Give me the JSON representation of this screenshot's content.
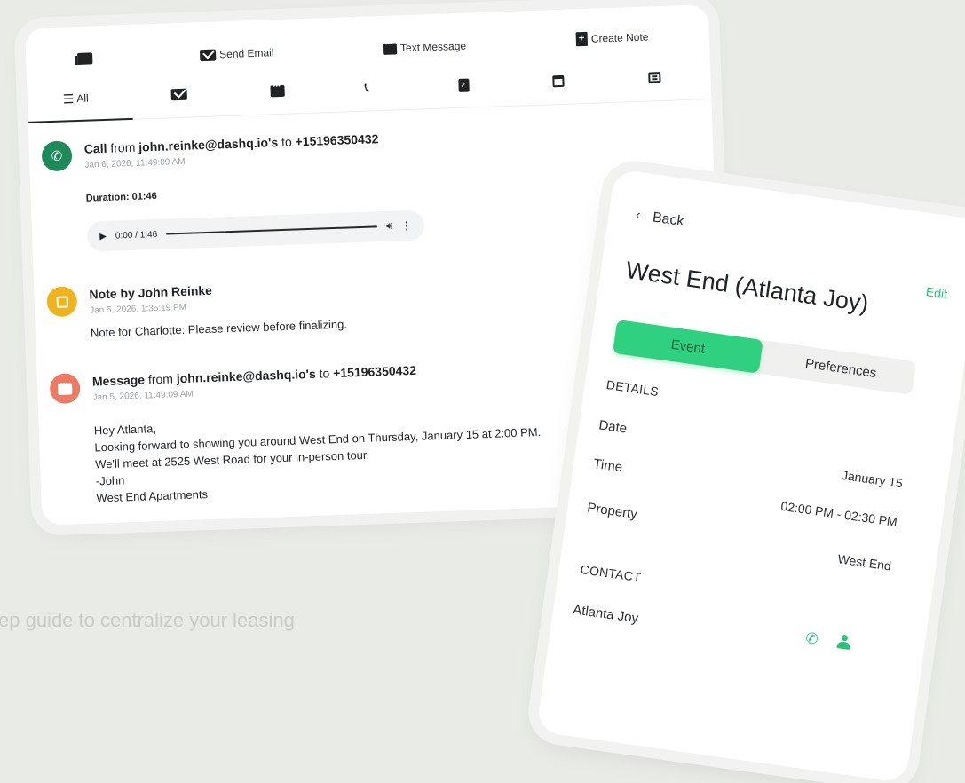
{
  "activity": {
    "toolbar": {
      "send_email": "Send Email",
      "text_message": "Text Message",
      "create_note": "Create Note"
    },
    "filters": {
      "all": "All"
    },
    "entries": [
      {
        "type_label": "Call",
        "from_word": "from",
        "sender": "john.reinke@dashq.io's",
        "to_word": "to",
        "recipient": "+15196350432",
        "time": "Jan 6, 2026, 11:49:09 AM",
        "duration": "Duration: 01:46",
        "player_time": "0:00 / 1:46"
      },
      {
        "type_label": "Note by John Reinke",
        "time": "Jan 5, 2026, 1:35:19 PM",
        "body": "Note for Charlotte: Please review before finalizing."
      },
      {
        "type_label": "Message",
        "from_word": "from",
        "sender": "john.reinke@dashq.io's",
        "to_word": "to",
        "recipient": "+15196350432",
        "time": "Jan 5, 2026, 11:49:09 AM",
        "body_lines": [
          "Hey Atlanta,",
          "Looking forward to showing you around West End on Thursday, January 15 at 2:00 PM.",
          "We'll meet at 2525 West Road for your in-person tour.",
          "-John",
          "West End Apartments"
        ]
      }
    ]
  },
  "event": {
    "back": "Back",
    "edit": "Edit",
    "title": "West End (Atlanta Joy)",
    "tabs": {
      "event": "Event",
      "preferences": "Preferences"
    },
    "details_heading": "DETAILS",
    "date_label": "Date",
    "date_value": "January 15",
    "time_label": "Time",
    "time_value": "02:00 PM - 02:30 PM",
    "property_label": "Property",
    "property_value": "West End",
    "contact_heading": "CONTACT",
    "contact_name": "Atlanta Joy"
  },
  "footer": "ep guide to centralize your leasing",
  "colors": {
    "green": "#2fd07f",
    "call": "#1e8a5a",
    "note": "#f1b31c",
    "message": "#ee7a63"
  }
}
